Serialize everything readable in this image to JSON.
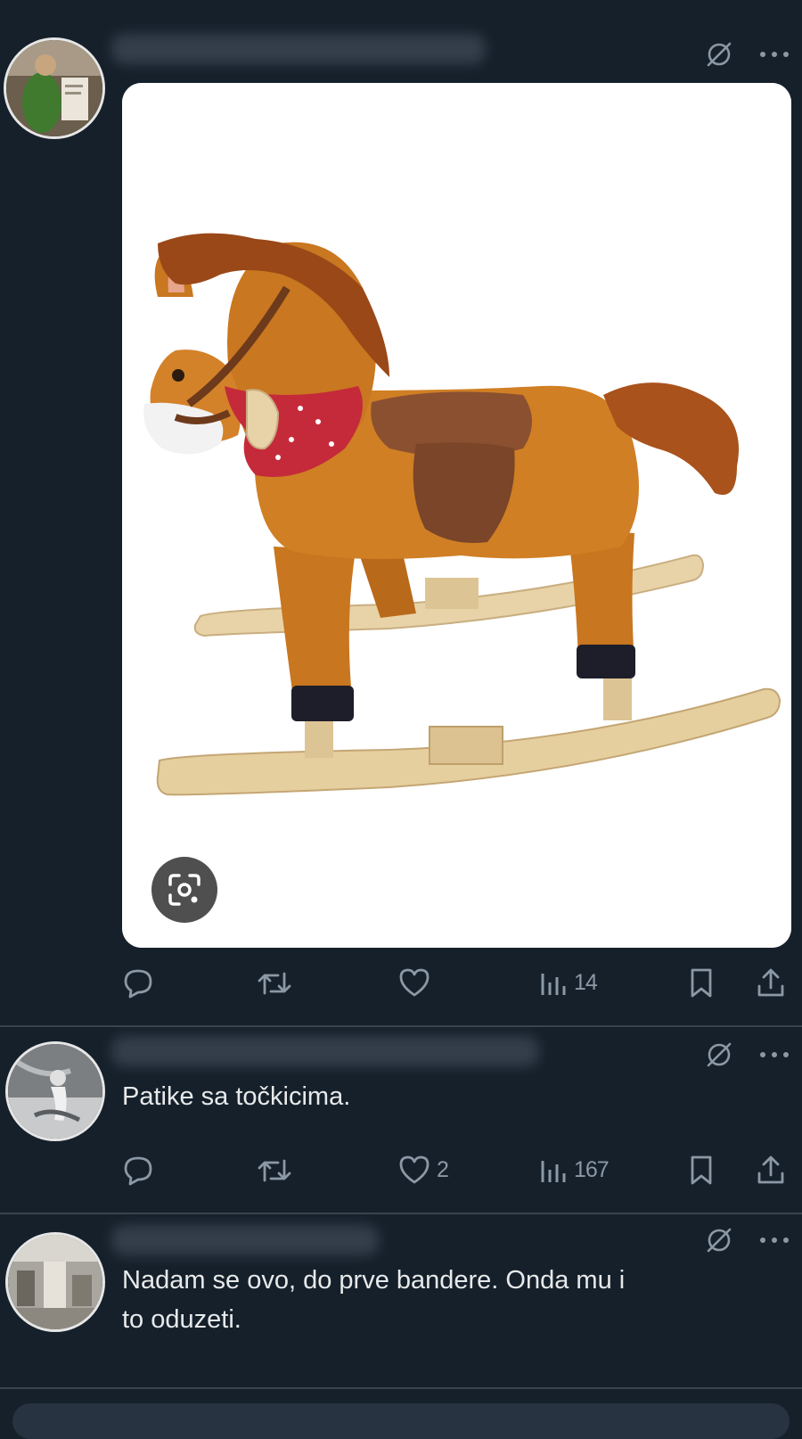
{
  "tweets": [
    {
      "id": "tweet-1",
      "avatar_desc": "profile-photo",
      "actions": {
        "reply": "",
        "retweet": "",
        "like": "",
        "views": "14"
      }
    },
    {
      "id": "tweet-2",
      "text": "Patike sa točkicima.",
      "actions": {
        "reply": "",
        "retweet": "",
        "like": "2",
        "views": "167"
      }
    },
    {
      "id": "tweet-3",
      "text_line1": "Nadam se ovo, do prve bandere. Onda mu i",
      "text_line2": "to oduzeti."
    }
  ],
  "icons": {
    "grok": "grok-icon",
    "more": "more-icon",
    "reply": "reply-icon",
    "retweet": "retweet-icon",
    "like": "heart-icon",
    "views": "views-icon",
    "bookmark": "bookmark-icon",
    "share": "share-icon",
    "lens": "google-lens-icon"
  },
  "colors": {
    "background": "#15202b",
    "text": "#e7e9ea",
    "muted": "#8b98a5",
    "divider": "#38444d"
  }
}
